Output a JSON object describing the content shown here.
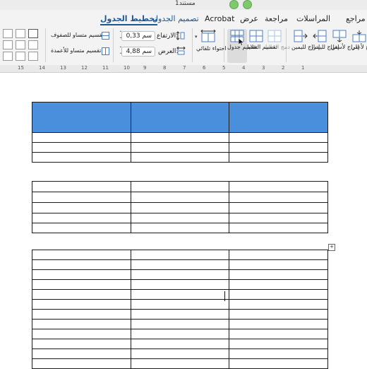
{
  "window": {
    "title": "مستند1"
  },
  "tabs": [
    {
      "label": "مراجع"
    },
    {
      "label": "المراسلات"
    },
    {
      "label": "مراجعة"
    },
    {
      "label": "عرض"
    },
    {
      "label": "Acrobat"
    },
    {
      "label": "تصميم الجدول"
    },
    {
      "label": "تخطيط الجدول"
    }
  ],
  "ribbon": {
    "insert_above": "إدراج لأعلى",
    "insert_below": "إدراج لأسفل",
    "insert_left": "إدراج لليسار",
    "insert_right": "إدراج لليمين",
    "merge_cells": "دمج الخلايا",
    "split_cells": "تقسيم الخلايا",
    "split_table": "تقسيم جدول",
    "autofit": "احتواء تلقائي",
    "height_label": "الارتفاع:",
    "height_value": "0,33 سم",
    "width_label": "العرض:",
    "width_value": "4,88 سم",
    "distribute_rows": "تقسيم متساو للصفوف",
    "distribute_cols": "تقسيم متساو للأعمدة"
  },
  "ruler": {
    "numbers": [
      "15",
      "14",
      "13",
      "12",
      "11",
      "10",
      "9",
      "8",
      "7",
      "6",
      "5",
      "4",
      "3",
      "2",
      "1"
    ]
  },
  "colors": {
    "header_fill": "#4a8fdc",
    "accent": "#1b5797"
  }
}
